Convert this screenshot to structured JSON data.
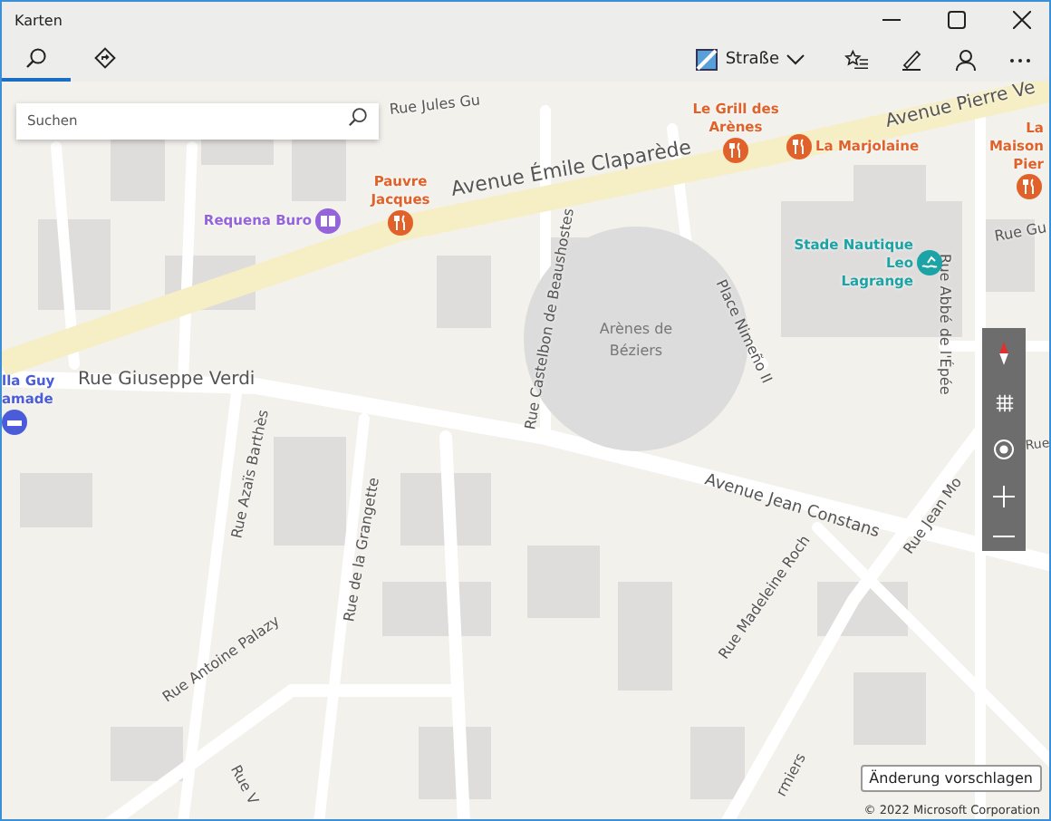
{
  "window": {
    "title": "Karten"
  },
  "tabs": [
    {
      "kind": "search",
      "selected": true
    },
    {
      "kind": "directions",
      "selected": false
    }
  ],
  "map_style": {
    "label": "Straße"
  },
  "search": {
    "placeholder": "Suchen"
  },
  "streets": [
    {
      "name": "Rue Jules Gu"
    },
    {
      "name": "Avenue Émile Claparède"
    },
    {
      "name": "Avenue Pierre Ve"
    },
    {
      "name": "Rue Giuseppe Verdi"
    },
    {
      "name": "Rue Castelbon de Beaushostes"
    },
    {
      "name": "Place Nimeño II"
    },
    {
      "name": "Rue Abbé de l'Épée"
    },
    {
      "name": "Avenue Jean Constans"
    },
    {
      "name": "Rue Azaïs Barthès"
    },
    {
      "name": "Rue de la Grangette"
    },
    {
      "name": "Rue Jean Mo"
    },
    {
      "name": "Rue Antoine Palazy"
    },
    {
      "name": "Rue V"
    },
    {
      "name": "Rue Madeleine Roch"
    },
    {
      "name": "rmiers"
    },
    {
      "name": "Rue Gu"
    },
    {
      "name": "Rue"
    }
  ],
  "landmark": {
    "name": "Arènes de\nBéziers"
  },
  "places": [
    {
      "name": "Le Grill des\nArènes",
      "kind": "restaurant",
      "color": "#e0622a"
    },
    {
      "name": "La Marjolaine",
      "kind": "restaurant",
      "color": "#e0622a"
    },
    {
      "name": "La Maison\nPier",
      "kind": "restaurant",
      "color": "#e0622a"
    },
    {
      "name": "Pauvre\nJacques",
      "kind": "restaurant",
      "color": "#e0622a"
    },
    {
      "name": "Requena Buro",
      "kind": "shop",
      "color": "#9464d8"
    },
    {
      "name": "Stade Nautique Leo\nLagrange",
      "kind": "sport",
      "color": "#1ba3a6"
    },
    {
      "name": "lla Guy\namade",
      "kind": "venue",
      "color": "#4a5cd8"
    }
  ],
  "feedback_button": {
    "label": "Änderung vorschlagen"
  },
  "copyright": "© 2022 Microsoft Corporation"
}
